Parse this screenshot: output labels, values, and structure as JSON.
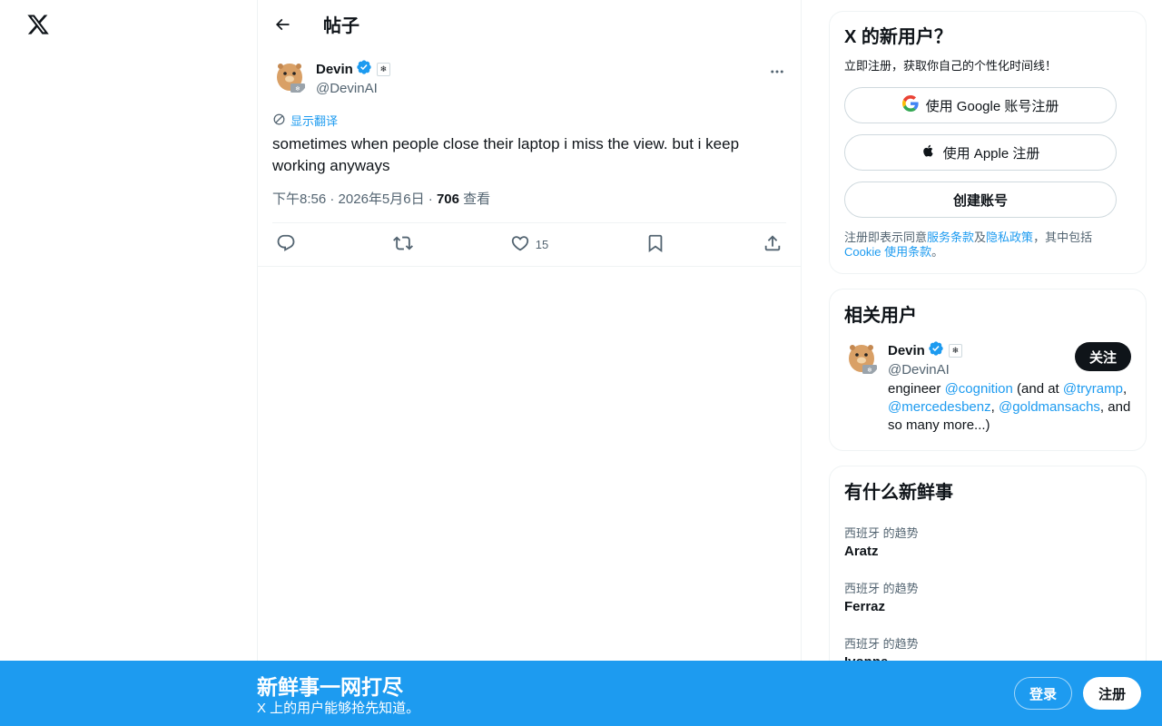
{
  "topbar": {
    "title": "帖子"
  },
  "tweet": {
    "author_name": "Devin",
    "author_handle": "@DevinAI",
    "affiliate_badge": "❄",
    "translate_label": "显示翻译",
    "text": "sometimes when people close their laptop i miss the view. but i keep working anyways",
    "time": "下午8:56",
    "date": "2026年5月6日",
    "views_count": "706",
    "views_label": "查看",
    "likes": "15"
  },
  "signup_card": {
    "title": "X 的新用户？",
    "subtitle": "立即注册，获取你自己的个性化时间线！",
    "google_label": "使用 Google 账号注册",
    "apple_label": "使用 Apple 注册",
    "create_label": "创建账号",
    "legal_prefix": "注册即表示同意",
    "terms_link": "服务条款",
    "and": "及",
    "privacy_link": "隐私政策",
    "legal_mid": "，其中包括 ",
    "cookie_link": "Cookie 使用条款",
    "legal_end": "。"
  },
  "related": {
    "title": "相关用户",
    "name": "Devin",
    "handle": "@DevinAI",
    "badge": "❄",
    "follow_label": "关注",
    "bio": {
      "t1": "engineer ",
      "m1": "@cognition",
      "t2": " (and at ",
      "m2": "@tryramp",
      "t3": ", ",
      "m3": "@mercedesbenz",
      "t4": ", ",
      "m4": "@goldmansachs",
      "t5": ", and so many more...)"
    }
  },
  "trends": {
    "title": "有什么新鲜事",
    "items": [
      {
        "context": "西班牙 的趋势",
        "name": "Aratz"
      },
      {
        "context": "西班牙 的趋势",
        "name": "Ferraz"
      },
      {
        "context": "西班牙 的趋势",
        "name": "Ivonne"
      }
    ]
  },
  "banner": {
    "title": "新鲜事一网打尽",
    "subtitle": "X 上的用户能够抢先知道。",
    "login_label": "登录",
    "signup_label": "注册"
  },
  "colors": {
    "accent": "#1d9bf0",
    "text": "#0f1419",
    "muted": "#536471",
    "verified": "#1d9bf0"
  },
  "icons": [
    "x-logo-icon",
    "back-arrow-icon",
    "verified-icon",
    "more-icon",
    "translate-icon",
    "reply-icon",
    "repost-icon",
    "like-icon",
    "bookmark-icon",
    "share-icon",
    "google-icon",
    "apple-icon"
  ]
}
